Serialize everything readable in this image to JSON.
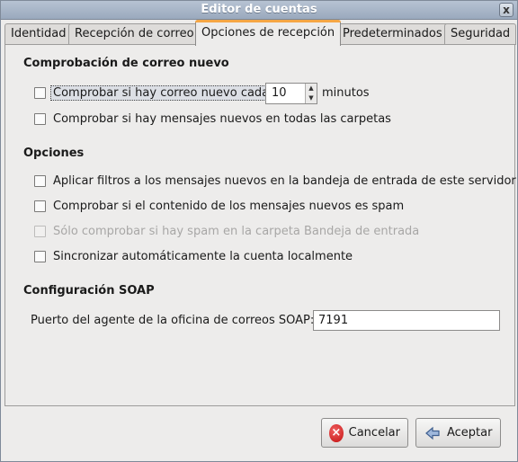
{
  "window": {
    "title": "Editor de cuentas",
    "close_glyph": "x"
  },
  "tabs": [
    {
      "label": "Identidad"
    },
    {
      "label": "Recepción de correo"
    },
    {
      "label": "Opciones de recepción",
      "active": true
    },
    {
      "label": "Predeterminados"
    },
    {
      "label": "Seguridad"
    }
  ],
  "new_mail": {
    "title": "Comprobación de correo nuevo",
    "check_every_label": "Comprobar si hay correo nuevo cada",
    "interval_value": "10",
    "minutes_label": "minutos",
    "all_folders_label": "Comprobar si hay mensajes nuevos en todas las carpetas"
  },
  "options": {
    "title": "Opciones",
    "apply_filters_label": "Aplicar filtros a los mensajes nuevos en la bandeja de entrada de este servidor",
    "check_spam_label": "Comprobar si el contenido de los mensajes nuevos es spam",
    "inbox_spam_only_label": "Sólo comprobar si hay spam en la carpeta Bandeja de entrada",
    "sync_local_label": "Sincronizar automáticamente la cuenta localmente"
  },
  "soap": {
    "title": "Configuración SOAP",
    "port_label": "Puerto del agente de la oficina de correos SOAP:",
    "port_value": "7191"
  },
  "buttons": {
    "cancel_label": "Cancelar",
    "accept_label": "Aceptar"
  },
  "icons": {
    "cancel": "cancel-icon",
    "accept": "accept-arrow-icon",
    "close": "close-icon"
  }
}
